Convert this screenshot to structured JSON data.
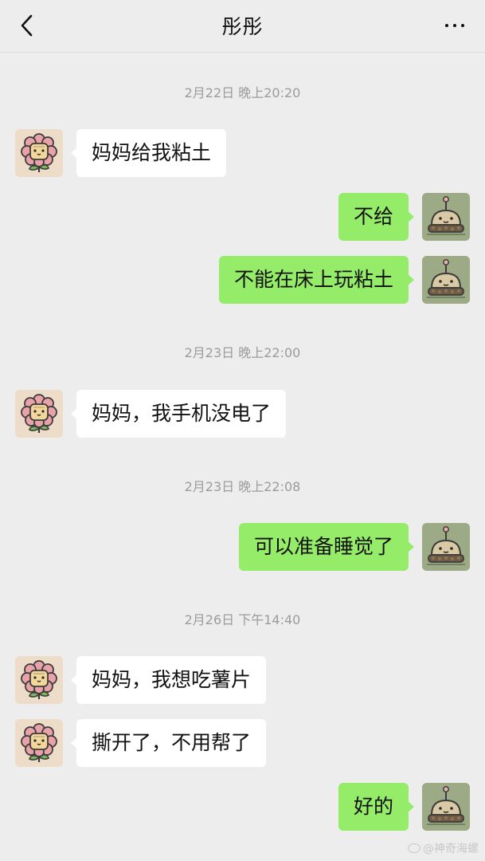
{
  "header": {
    "title": "彤彤",
    "back_icon": "chevron-left-icon",
    "more_icon": "more-dots-icon"
  },
  "timestamps": [
    "2月22日 晚上20:20",
    "2月23日 晚上22:00",
    "2月23日 晚上22:08",
    "2月26日 下午14:40"
  ],
  "messages": [
    {
      "side": "left",
      "text": "妈妈给我粘土"
    },
    {
      "side": "right",
      "text": "不给"
    },
    {
      "side": "right",
      "text": "不能在床上玩粘土"
    },
    {
      "side": "left",
      "text": "妈妈，我手机没电了"
    },
    {
      "side": "right",
      "text": "可以准备睡觉了"
    },
    {
      "side": "left",
      "text": "妈妈，我想吃薯片"
    },
    {
      "side": "left",
      "text": "撕开了，不用帮了"
    },
    {
      "side": "right",
      "text": "好的"
    }
  ],
  "avatars": {
    "left": "flower-avatar-icon",
    "right": "cake-avatar-icon"
  },
  "watermark": {
    "text": "@神奇海螺",
    "icon": "weibo-icon"
  },
  "colors": {
    "background": "#ededed",
    "sent_bubble": "#95ec69",
    "received_bubble": "#ffffff",
    "timestamp_text": "#9b9b9b"
  }
}
